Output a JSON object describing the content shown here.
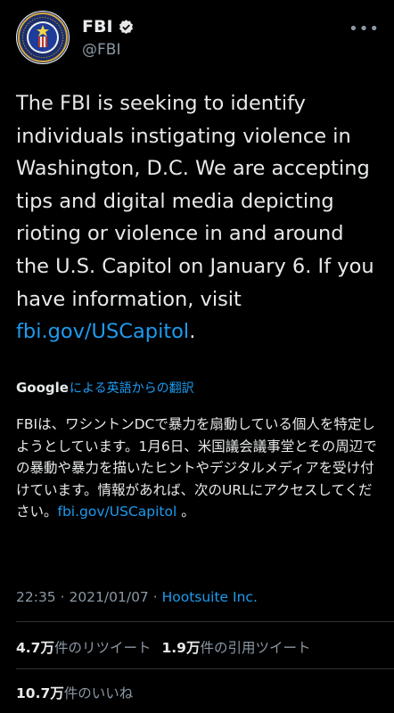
{
  "author": {
    "display_name": "FBI",
    "handle": "@FBI",
    "verified": true
  },
  "tweet": {
    "text_before_link": "The FBI is seeking to identify individuals instigating violence in Washington, D.C. We are accepting tips and digital media depicting rioting or violence in and around the U.S. Capitol on January 6. If you have information, visit ",
    "link_text": "fbi.gov/USCapitol",
    "text_after_link": "."
  },
  "translation": {
    "google_label": "Google",
    "translate_label": "による英語からの翻訳",
    "text_before_link": "FBIは、ワシントンDCで暴力を扇動している個人を特定しようとしています。1月6日、米国議会議事堂とその周辺での暴動や暴力を描いたヒントやデジタルメディアを受け付けています。情報があれば、次のURLにアクセスしてください。",
    "link_text": "fbi.gov/USCapitol",
    "text_after_link": " 。"
  },
  "meta": {
    "time": "22:35",
    "date": "2021/01/07",
    "separator": " · ",
    "source": "Hootsuite Inc."
  },
  "stats": {
    "retweets_num": "4.7万",
    "retweets_label": "件のリツイート",
    "quotes_num": "1.9万",
    "quotes_label": "件の引用ツイート",
    "likes_num": "10.7万",
    "likes_label": "件のいいね"
  },
  "icons": {
    "more": "more-icon",
    "verified": "verified-badge-icon",
    "avatar": "fbi-seal"
  },
  "colors": {
    "background": "#000000",
    "text": "#e7e9ea",
    "secondary": "#8b98a5",
    "link": "#1d9bf0"
  }
}
